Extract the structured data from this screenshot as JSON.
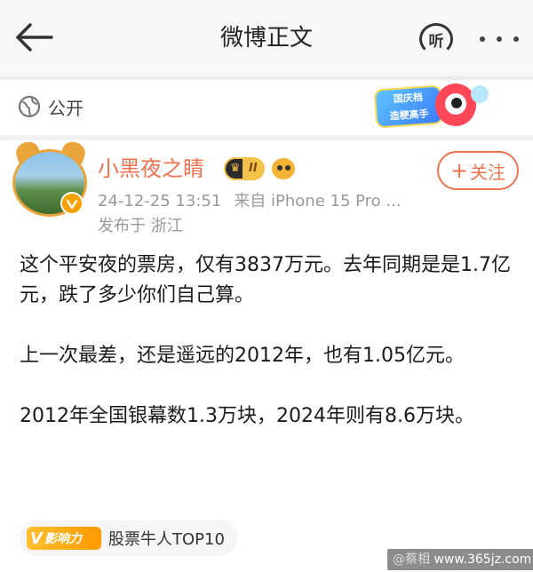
{
  "nav": {
    "title": "微博正文",
    "listen_label": "听"
  },
  "privacy": {
    "label": "公开"
  },
  "promo": {
    "line1": "国庆档",
    "line2": "造梗高手"
  },
  "author": {
    "name": "小黑夜之睛",
    "vip_level": "II",
    "timestamp": "24-12-25 13:51",
    "source": "来自 iPhone 15 Pro ...",
    "location": "发布于 浙江",
    "follow_label": "关注"
  },
  "post": {
    "paragraphs": [
      "这个平安夜的票房，仅有3837万元。去年同期是是1.7亿元，跌了多少你们自己算。",
      "上一次最差，还是遥远的2012年，也有1.05亿元。",
      "2012年全国银幕数1.3万块，2024年则有8.6万块。"
    ]
  },
  "topic": {
    "badge": "影响力",
    "label": "股票牛人TOP10"
  },
  "watermark": {
    "prefix": "@蔡相",
    "site": "www.365jz.com"
  },
  "colors": {
    "accent": "#eb7350",
    "meta": "#999999",
    "gold": "#f7a000"
  }
}
